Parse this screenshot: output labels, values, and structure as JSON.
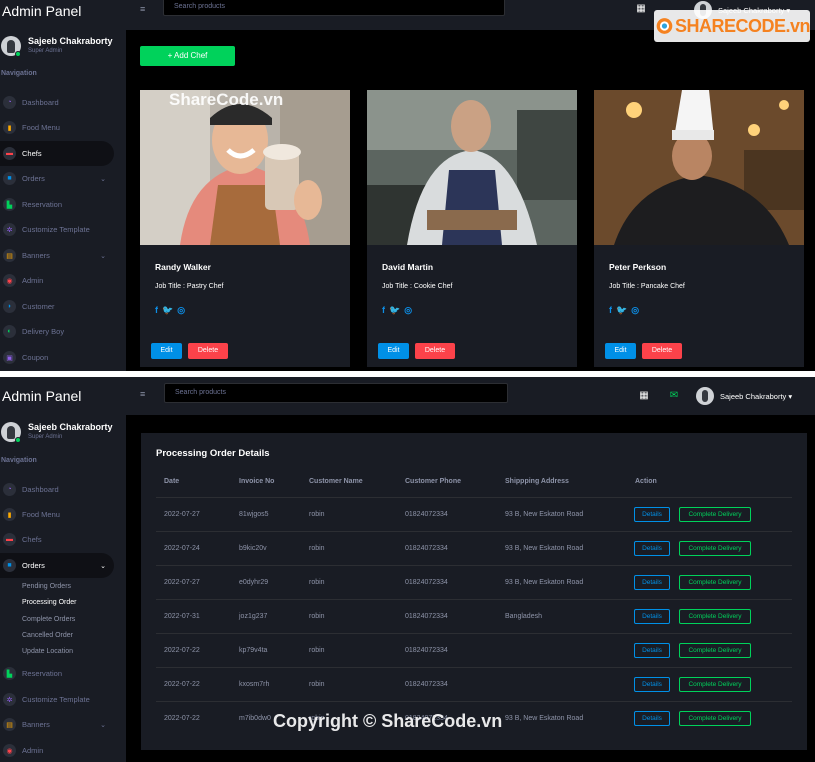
{
  "brand": {
    "title": "Admin Panel"
  },
  "user": {
    "name": "Sajeeb Chakraborty",
    "role": "Super Admin",
    "menu_name": "Sajeeb Chakraborty ▾"
  },
  "search": {
    "placeholder": "Search products"
  },
  "sidebar": {
    "heading": "Navigation",
    "items_top": [
      {
        "label": "Dashboard",
        "icon": "dashboard-icon"
      },
      {
        "label": "Food Menu",
        "icon": "food-menu-icon"
      },
      {
        "label": "Chefs",
        "icon": "chefs-icon"
      },
      {
        "label": "Orders",
        "icon": "orders-icon"
      },
      {
        "label": "Reservation",
        "icon": "reservation-icon"
      },
      {
        "label": "Customize Template",
        "icon": "settings-icon"
      },
      {
        "label": "Banners",
        "icon": "banners-icon"
      },
      {
        "label": "Admin",
        "icon": "admin-icon"
      },
      {
        "label": "Customer",
        "icon": "customer-icon"
      },
      {
        "label": "Delivery Boy",
        "icon": "delivery-icon"
      },
      {
        "label": "Coupon",
        "icon": "coupon-icon"
      }
    ],
    "items_bottom": [
      {
        "label": "Dashboard"
      },
      {
        "label": "Food Menu"
      },
      {
        "label": "Chefs"
      },
      {
        "label": "Orders"
      },
      {
        "label": "Reservation"
      },
      {
        "label": "Customize Template"
      },
      {
        "label": "Banners"
      },
      {
        "label": "Admin"
      }
    ],
    "orders_sub": [
      "Pending Orders",
      "Processing Order",
      "Complete Orders",
      "Cancelled Order",
      "Update Location"
    ]
  },
  "chefs_page": {
    "add_label": "+ Add Chef",
    "edit_label": "Edit",
    "delete_label": "Delete",
    "chefs": [
      {
        "name": "Randy Walker",
        "job": "Job Title : Pastry Chef"
      },
      {
        "name": "David Martin",
        "job": "Job Title : Cookie Chef"
      },
      {
        "name": "Peter Perkson",
        "job": "Job Title : Pancake Chef"
      }
    ]
  },
  "orders_page": {
    "title": "Processing Order Details",
    "columns": [
      "Date",
      "Invoice No",
      "Customer Name",
      "Customer Phone",
      "Shippping Address",
      "Action"
    ],
    "details_label": "Details",
    "complete_label": "Complete Delivery",
    "rows": [
      [
        "2022-07-27",
        "81wjgos5",
        "robin",
        "01824072334",
        "93 B, New Eskaton Road"
      ],
      [
        "2022-07-24",
        "b9kic20v",
        "robin",
        "01824072334",
        "93 B, New Eskaton Road"
      ],
      [
        "2022-07-27",
        "e0dyhr29",
        "robin",
        "01824072334",
        "93 B, New Eskaton Road"
      ],
      [
        "2022-07-31",
        "joz1g237",
        "robin",
        "01824072334",
        "Bangladesh"
      ],
      [
        "2022-07-22",
        "kp79v4ta",
        "robin",
        "01824072334",
        ""
      ],
      [
        "2022-07-22",
        "kxosm7rh",
        "robin",
        "01824072334",
        ""
      ],
      [
        "2022-07-22",
        "m7ib0dw0",
        "robin",
        "01824072334",
        "93 B, New Eskaton Road"
      ]
    ]
  },
  "watermarks": {
    "logo_text": "SHARECODE.vn",
    "photo_text": "ShareCode.vn",
    "copyright": "Copyright © ShareCode.vn"
  },
  "colors": {
    "accent_green": "#00d25b",
    "accent_blue": "#0090e7",
    "accent_red": "#fc424a",
    "panel": "#191c24"
  }
}
